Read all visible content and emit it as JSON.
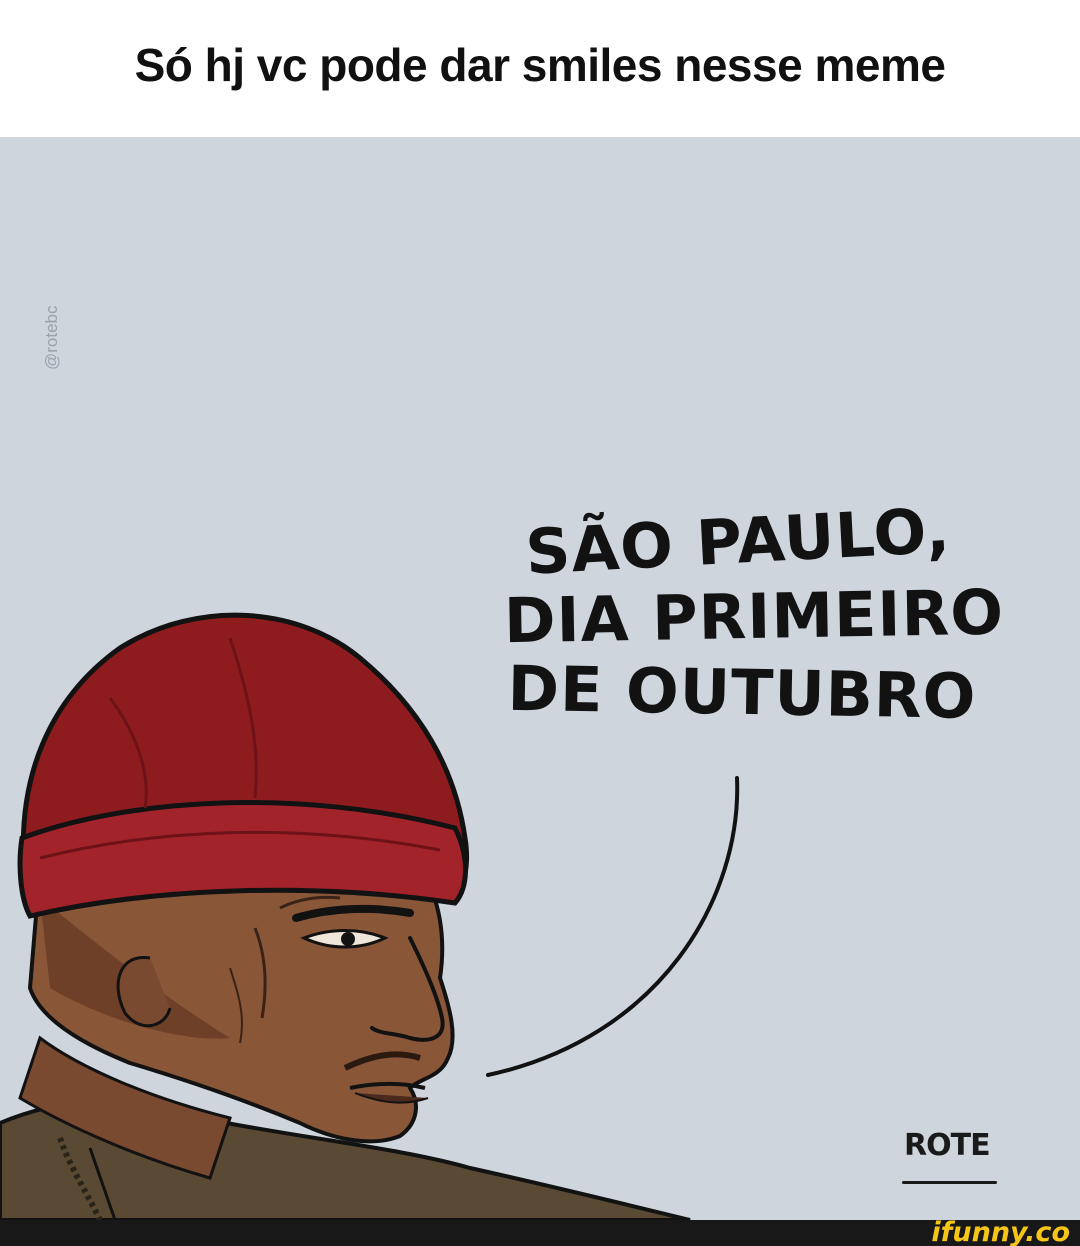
{
  "caption": {
    "text": "Só hj vc pode dar smiles nesse meme"
  },
  "comic": {
    "watermark_handle": "@rotebc",
    "speech_lines": [
      "SÃO PAULO,",
      "DIA PRIMEIRO",
      "DE OUTUBRO"
    ],
    "signature": "ROTE",
    "colors": {
      "background": "#cfd5dd",
      "beanie": "#8e1c1f",
      "skin": "#8a5638",
      "jacket": "#5a4a33",
      "outline": "#121212"
    }
  },
  "footer": {
    "brand": "ifunny.co",
    "brand_color": "#f5c518"
  }
}
